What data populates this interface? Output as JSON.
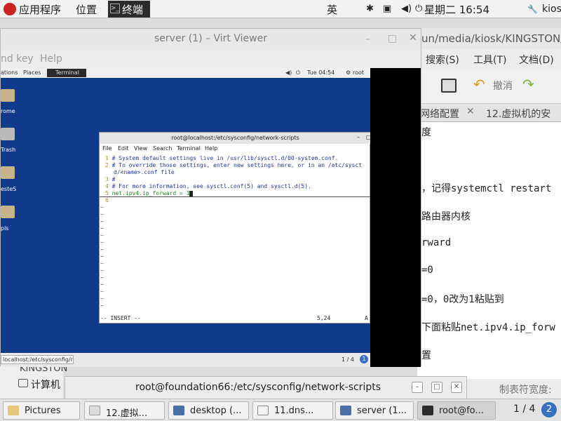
{
  "topbar": {
    "apps_label": "应用程序",
    "places_label": "位置",
    "terminal_label": "终端",
    "input_method": "英",
    "clock": "星期二 16:54",
    "user": "kiosk"
  },
  "bg_editor": {
    "path": "un/media/kiosk/KINGSTON/l",
    "menu": [
      "搜索(S)",
      "工具(T)",
      "文档(D)"
    ],
    "undo_label": "撤消",
    "tabs": [
      "网络配置",
      "12.虚拟机的安"
    ],
    "lines": [
      "度",
      "，记得systemctl restart",
      "路由器内核",
      "rward",
      "=0",
      "=0，0改为1粘贴到",
      "下面粘贴net.ipv4.ip_forw",
      "置"
    ],
    "tab_width_label": "制表符宽度:"
  },
  "left_strip": {
    "kingston": "KINGSTON",
    "computer": "计算机"
  },
  "virt_viewer": {
    "title": "server (1) – Virt Viewer",
    "menu_send_key": "nd key",
    "menu_help": "Help",
    "guest": {
      "top_items": [
        "ations",
        "Places",
        "Terminal"
      ],
      "clock": "Tue 04:54",
      "user": "root",
      "desktop_icons": [
        "rome",
        "Trash",
        "esteS",
        "pls"
      ],
      "bottom_task": "localhost:/etc/sysconfig/n...",
      "workspace": "1 / 4",
      "terminal": {
        "title": "root@localhost:/etc/sysconfig/network-scripts",
        "menu": [
          "File",
          "Edit",
          "View",
          "Search",
          "Terminal",
          "Help"
        ],
        "lines": [
          {
            "n": "1",
            "t": "# System default settings live in /usr/lib/sysctl.d/00-system.conf."
          },
          {
            "n": "2",
            "t": "# To override those settings, enter new settings here, or in an /etc/sysct"
          },
          {
            "n": "",
            "t": "d/<name>.conf file"
          },
          {
            "n": "3",
            "t": "#"
          },
          {
            "n": "4",
            "t": "# For more information, see sysctl.conf(5) and sysctl.d(5)."
          },
          {
            "n": "5",
            "t": "net.ipv4.ip_forward = 1"
          },
          {
            "n": "6",
            "t": ""
          }
        ],
        "mode": "-- INSERT --",
        "position": "5,24",
        "scroll": "A"
      }
    }
  },
  "foundation_terminal": {
    "title": "root@foundation66:/etc/sysconfig/network-scripts"
  },
  "taskbar": {
    "items": [
      "Pictures",
      "12.虚拟...",
      "desktop (...",
      "11.dns...",
      "server (1...",
      "root@fo..."
    ],
    "workspace": "1 / 4",
    "workspace_badge": "2"
  },
  "colors": {
    "guest_desktop": "#123a8b",
    "editor_bg": "#ffffff",
    "topbar": "#f2f2f2"
  }
}
